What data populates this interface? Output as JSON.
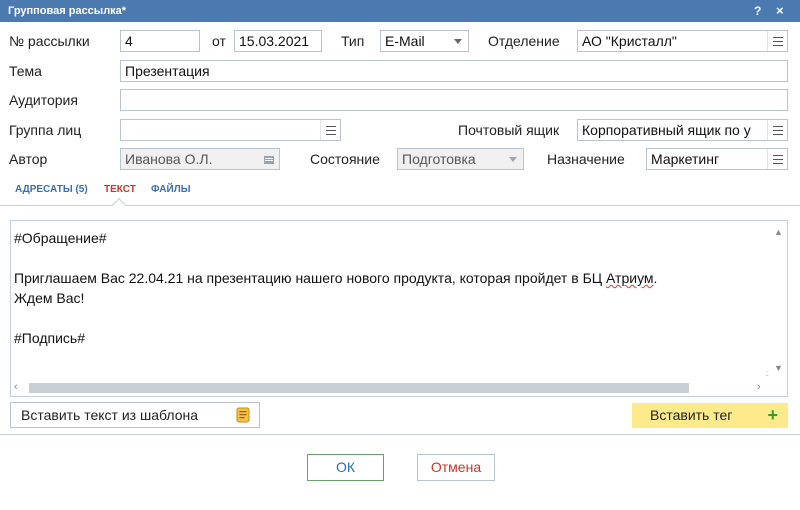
{
  "window": {
    "title": "Групповая рассылка*",
    "help_label": "?",
    "close_label": "×"
  },
  "form": {
    "number": {
      "label": "№ рассылки",
      "value": "4"
    },
    "date": {
      "label": "от",
      "value": "15.03.2021"
    },
    "type": {
      "label": "Тип",
      "value": "E-Mail"
    },
    "department": {
      "label": "Отделение",
      "value": "АО \"Кристалл\""
    },
    "subject": {
      "label": "Тема",
      "value": "Презентация"
    },
    "audience": {
      "label": "Аудитория",
      "value": ""
    },
    "group": {
      "label": "Группа лиц",
      "value": ""
    },
    "mailbox": {
      "label": "Почтовый ящик",
      "value": "Корпоративный ящик по у"
    },
    "author": {
      "label": "Автор",
      "value": "Иванова О.Л."
    },
    "state": {
      "label": "Состояние",
      "value": "Подготовка"
    },
    "purpose": {
      "label": "Назначение",
      "value": "Маркетинг"
    }
  },
  "tabs": [
    {
      "label": "АДРЕСАТЫ (5)",
      "active": false
    },
    {
      "label": "ТЕКСТ",
      "active": true
    },
    {
      "label": "ФАЙЛЫ",
      "active": false
    }
  ],
  "editor": {
    "lines": [
      "#Обращение#",
      "",
      "Приглашаем Вас 22.04.21 на презентацию нашего нового продукта, которая пройдет в ",
      "Ждем Вас!",
      "",
      "#Подпись#"
    ],
    "line3_suffix_plain": "БЦ ",
    "line3_suffix_spell": "Атриум",
    "line3_end": "."
  },
  "actions": {
    "insert_template": "Вставить текст из шаблона",
    "insert_tag": "Вставить тег",
    "ok": "ОК",
    "cancel": "Отмена"
  },
  "colors": {
    "titlebar": "#4a7ab0",
    "tab_active": "#c0392b",
    "tab_inactive": "#3a6fb0",
    "insert_tag_bg": "#fdeb8b",
    "plus": "#3b9b2f"
  },
  "icons": {
    "menu_button": "menu-icon",
    "dropdown": "chevron-down-icon",
    "author_lookup": "list-icon",
    "template": "scroll-icon",
    "add": "plus-icon"
  }
}
